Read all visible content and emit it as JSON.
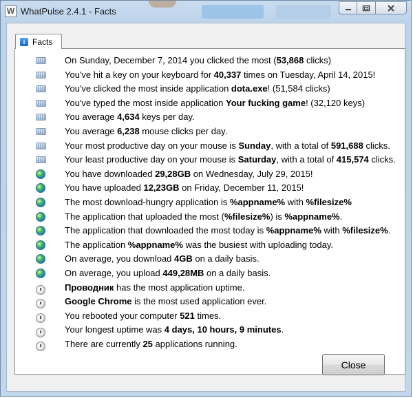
{
  "window": {
    "title": "WhatPulse 2.4.1 - Facts",
    "app_icon_letter": "W"
  },
  "tab": {
    "label": "Facts",
    "icon": "info-icon"
  },
  "facts": [
    {
      "icon": "keyboard-icon",
      "parts": [
        [
          "On Sunday, December 7, 2014 you clicked the most (",
          false
        ],
        [
          "53,868",
          true
        ],
        [
          " clicks)",
          false
        ]
      ]
    },
    {
      "icon": "keyboard-icon",
      "parts": [
        [
          "You've hit a key on your keyboard for ",
          false
        ],
        [
          "40,337",
          true
        ],
        [
          " times on Tuesday, April 14, 2015!",
          false
        ]
      ]
    },
    {
      "icon": "keyboard-icon",
      "parts": [
        [
          "You've clicked the most inside application ",
          false
        ],
        [
          "dota.exe",
          true
        ],
        [
          "! (51,584 clicks)",
          false
        ]
      ]
    },
    {
      "icon": "keyboard-icon",
      "parts": [
        [
          "You've typed the most inside application ",
          false
        ],
        [
          "Your fucking game",
          true
        ],
        [
          "! (32,120 keys)",
          false
        ]
      ]
    },
    {
      "icon": "keyboard-icon",
      "parts": [
        [
          "You average ",
          false
        ],
        [
          "4,634",
          true
        ],
        [
          " keys per day.",
          false
        ]
      ]
    },
    {
      "icon": "keyboard-icon",
      "parts": [
        [
          "You average ",
          false
        ],
        [
          "6,238",
          true
        ],
        [
          " mouse clicks per day.",
          false
        ]
      ]
    },
    {
      "icon": "keyboard-icon",
      "parts": [
        [
          "Your most productive day on your mouse is ",
          false
        ],
        [
          "Sunday",
          true
        ],
        [
          ", with a total of ",
          false
        ],
        [
          "591,688",
          true
        ],
        [
          " clicks.",
          false
        ]
      ]
    },
    {
      "icon": "keyboard-icon",
      "parts": [
        [
          "Your least productive day on your mouse is ",
          false
        ],
        [
          "Saturday",
          true
        ],
        [
          ", with a total of ",
          false
        ],
        [
          "415,574",
          true
        ],
        [
          " clicks.",
          false
        ]
      ]
    },
    {
      "icon": "globe-icon",
      "parts": [
        [
          "You have downloaded ",
          false
        ],
        [
          "29,28GB",
          true
        ],
        [
          " on Wednesday, July 29, 2015!",
          false
        ]
      ]
    },
    {
      "icon": "globe-icon",
      "parts": [
        [
          "You have uploaded ",
          false
        ],
        [
          "12,23GB",
          true
        ],
        [
          " on Friday, December 11, 2015!",
          false
        ]
      ]
    },
    {
      "icon": "globe-icon",
      "parts": [
        [
          "The most download-hungry application is ",
          false
        ],
        [
          "%appname%",
          true
        ],
        [
          " with ",
          false
        ],
        [
          "%filesize%",
          true
        ]
      ]
    },
    {
      "icon": "globe-icon",
      "parts": [
        [
          "The application that uploaded the most (",
          false
        ],
        [
          "%filesize%",
          true
        ],
        [
          ") is ",
          false
        ],
        [
          "%appname%",
          true
        ],
        [
          ".",
          false
        ]
      ]
    },
    {
      "icon": "globe-icon",
      "parts": [
        [
          "The application that downloaded the most today is ",
          false
        ],
        [
          "%appname%",
          true
        ],
        [
          " with ",
          false
        ],
        [
          "%filesize%",
          true
        ],
        [
          ".",
          false
        ]
      ]
    },
    {
      "icon": "globe-icon",
      "parts": [
        [
          "The application ",
          false
        ],
        [
          "%appname%",
          true
        ],
        [
          " was the busiest with uploading today.",
          false
        ]
      ]
    },
    {
      "icon": "globe-icon",
      "parts": [
        [
          "On average, you download ",
          false
        ],
        [
          "4GB",
          true
        ],
        [
          " on a daily basis.",
          false
        ]
      ]
    },
    {
      "icon": "globe-icon",
      "parts": [
        [
          "On average, you upload ",
          false
        ],
        [
          "449,28MB",
          true
        ],
        [
          " on a daily basis.",
          false
        ]
      ]
    },
    {
      "icon": "clock-icon",
      "parts": [
        [
          "Проводник",
          true
        ],
        [
          " has the most application uptime.",
          false
        ]
      ]
    },
    {
      "icon": "clock-icon",
      "parts": [
        [
          "Google Chrome",
          true
        ],
        [
          " is the most used application ever.",
          false
        ]
      ]
    },
    {
      "icon": "clock-icon",
      "parts": [
        [
          "You rebooted your computer ",
          false
        ],
        [
          "521",
          true
        ],
        [
          " times.",
          false
        ]
      ]
    },
    {
      "icon": "clock-icon",
      "parts": [
        [
          "Your longest uptime was ",
          false
        ],
        [
          "4 days, 10 hours, 9 minutes",
          true
        ],
        [
          ".",
          false
        ]
      ]
    },
    {
      "icon": "clock-icon",
      "parts": [
        [
          "There are currently ",
          false
        ],
        [
          "25",
          true
        ],
        [
          " applications running.",
          false
        ]
      ]
    }
  ],
  "buttons": {
    "close_label": "Close"
  }
}
